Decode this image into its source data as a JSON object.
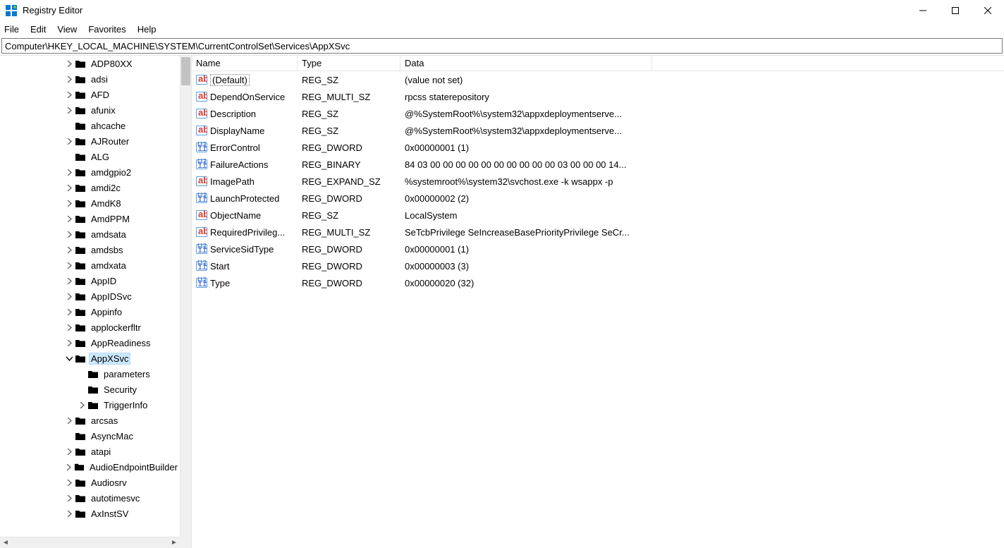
{
  "window": {
    "title": "Registry Editor"
  },
  "menu": {
    "file": "File",
    "edit": "Edit",
    "view": "View",
    "favorites": "Favorites",
    "help": "Help"
  },
  "address": "Computer\\HKEY_LOCAL_MACHINE\\SYSTEM\\CurrentControlSet\\Services\\AppXSvc",
  "columns": {
    "name": "Name",
    "type": "Type",
    "data": "Data"
  },
  "tree": [
    {
      "indent": 5,
      "chev": "right",
      "label": "ADP80XX"
    },
    {
      "indent": 5,
      "chev": "right",
      "label": "adsi"
    },
    {
      "indent": 5,
      "chev": "right",
      "label": "AFD"
    },
    {
      "indent": 5,
      "chev": "right",
      "label": "afunix"
    },
    {
      "indent": 5,
      "chev": "",
      "label": "ahcache"
    },
    {
      "indent": 5,
      "chev": "right",
      "label": "AJRouter"
    },
    {
      "indent": 5,
      "chev": "",
      "label": "ALG"
    },
    {
      "indent": 5,
      "chev": "right",
      "label": "amdgpio2"
    },
    {
      "indent": 5,
      "chev": "right",
      "label": "amdi2c"
    },
    {
      "indent": 5,
      "chev": "right",
      "label": "AmdK8"
    },
    {
      "indent": 5,
      "chev": "right",
      "label": "AmdPPM"
    },
    {
      "indent": 5,
      "chev": "right",
      "label": "amdsata"
    },
    {
      "indent": 5,
      "chev": "right",
      "label": "amdsbs"
    },
    {
      "indent": 5,
      "chev": "right",
      "label": "amdxata"
    },
    {
      "indent": 5,
      "chev": "right",
      "label": "AppID"
    },
    {
      "indent": 5,
      "chev": "right",
      "label": "AppIDSvc"
    },
    {
      "indent": 5,
      "chev": "right",
      "label": "Appinfo"
    },
    {
      "indent": 5,
      "chev": "right",
      "label": "applockerfltr"
    },
    {
      "indent": 5,
      "chev": "right",
      "label": "AppReadiness"
    },
    {
      "indent": 5,
      "chev": "down",
      "label": "AppXSvc",
      "selected": true
    },
    {
      "indent": 6,
      "chev": "",
      "label": "parameters"
    },
    {
      "indent": 6,
      "chev": "",
      "label": "Security"
    },
    {
      "indent": 6,
      "chev": "right",
      "label": "TriggerInfo"
    },
    {
      "indent": 5,
      "chev": "right",
      "label": "arcsas"
    },
    {
      "indent": 5,
      "chev": "",
      "label": "AsyncMac"
    },
    {
      "indent": 5,
      "chev": "right",
      "label": "atapi"
    },
    {
      "indent": 5,
      "chev": "right",
      "label": "AudioEndpointBuilder"
    },
    {
      "indent": 5,
      "chev": "right",
      "label": "Audiosrv"
    },
    {
      "indent": 5,
      "chev": "right",
      "label": "autotimesvc"
    },
    {
      "indent": 5,
      "chev": "right",
      "label": "AxInstSV"
    }
  ],
  "values": [
    {
      "icon": "sz",
      "name": "(Default)",
      "default": true,
      "type": "REG_SZ",
      "data": "(value not set)"
    },
    {
      "icon": "sz",
      "name": "DependOnService",
      "type": "REG_MULTI_SZ",
      "data": "rpcss staterepository"
    },
    {
      "icon": "sz",
      "name": "Description",
      "type": "REG_SZ",
      "data": "@%SystemRoot%\\system32\\appxdeploymentserve..."
    },
    {
      "icon": "sz",
      "name": "DisplayName",
      "type": "REG_SZ",
      "data": "@%SystemRoot%\\system32\\appxdeploymentserve..."
    },
    {
      "icon": "bin",
      "name": "ErrorControl",
      "type": "REG_DWORD",
      "data": "0x00000001 (1)"
    },
    {
      "icon": "bin",
      "name": "FailureActions",
      "type": "REG_BINARY",
      "data": "84 03 00 00 00 00 00 00 00 00 00 00 03 00 00 00 14..."
    },
    {
      "icon": "sz",
      "name": "ImagePath",
      "type": "REG_EXPAND_SZ",
      "data": "%systemroot%\\system32\\svchost.exe -k wsappx -p"
    },
    {
      "icon": "bin",
      "name": "LaunchProtected",
      "type": "REG_DWORD",
      "data": "0x00000002 (2)"
    },
    {
      "icon": "sz",
      "name": "ObjectName",
      "type": "REG_SZ",
      "data": "LocalSystem"
    },
    {
      "icon": "sz",
      "name": "RequiredPrivileg...",
      "type": "REG_MULTI_SZ",
      "data": "SeTcbPrivilege SeIncreaseBasePriorityPrivilege SeCr..."
    },
    {
      "icon": "bin",
      "name": "ServiceSidType",
      "type": "REG_DWORD",
      "data": "0x00000001 (1)"
    },
    {
      "icon": "bin",
      "name": "Start",
      "type": "REG_DWORD",
      "data": "0x00000003 (3)"
    },
    {
      "icon": "bin",
      "name": "Type",
      "type": "REG_DWORD",
      "data": "0x00000020 (32)"
    }
  ]
}
